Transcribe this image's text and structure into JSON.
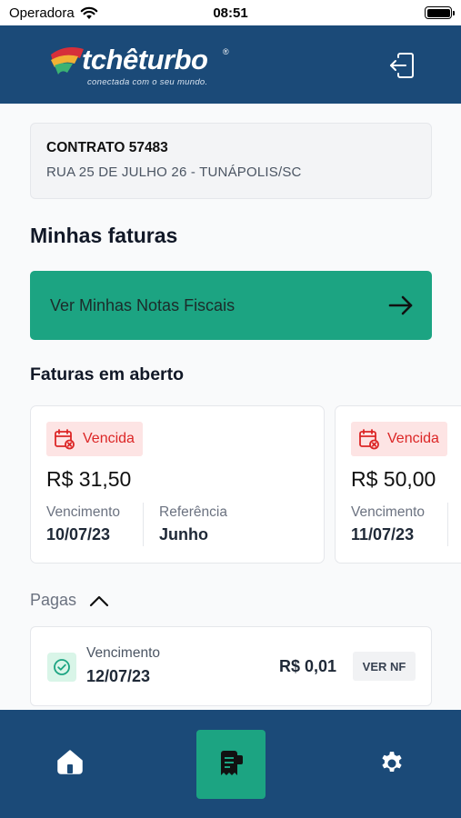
{
  "status_bar": {
    "carrier": "Operadora",
    "time": "08:51"
  },
  "header": {
    "logo_text": "tchêturbo",
    "logo_registered": "®",
    "logo_tagline": "conectada com o seu mundo.",
    "logout_icon": "logout-icon",
    "brand_color": "#1b4a78"
  },
  "contract": {
    "title": "CONTRATO 57483",
    "address": "RUA 25 DE JULHO 26 - TUNÁPOLIS/SC"
  },
  "sections": {
    "my_invoices_title": "Minhas faturas",
    "nf_button_label": "Ver Minhas Notas Fiscais",
    "open_invoices_title": "Faturas em aberto",
    "paid_toggle_label": "Pagas"
  },
  "open_invoices": [
    {
      "status": "Vencida",
      "amount": "R$ 31,50",
      "due_label": "Vencimento",
      "due_date": "10/07/23",
      "ref_label": "Referência",
      "ref_value": "Junho"
    },
    {
      "status": "Vencida",
      "amount": "R$ 50,00",
      "due_label": "Vencimento",
      "due_date": "11/07/23"
    }
  ],
  "paid_invoices": [
    {
      "due_label": "Vencimento",
      "due_date": "12/07/23",
      "amount": "R$ 0,01",
      "action": "VER NF"
    }
  ],
  "bottom_nav": {
    "items": [
      {
        "icon": "home-icon"
      },
      {
        "icon": "invoice-icon",
        "active": true
      },
      {
        "icon": "gear-icon"
      }
    ]
  },
  "colors": {
    "accent": "#1ca482",
    "overdue": "#dc2626",
    "overdue_bg": "#fde4e4",
    "paid_bg": "#d9f5e8"
  }
}
